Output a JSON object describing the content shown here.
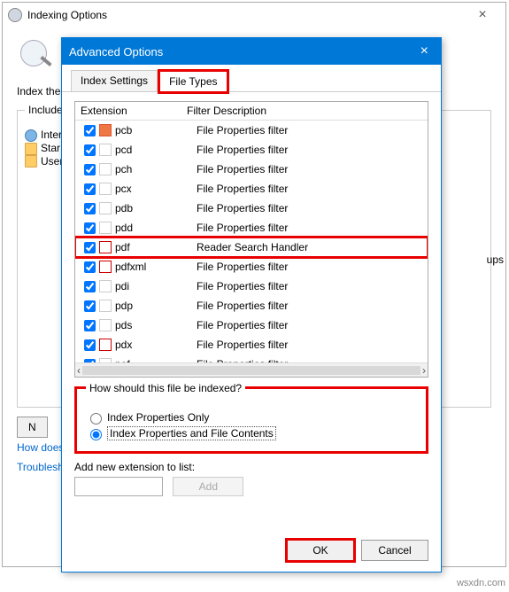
{
  "parent": {
    "title": "Indexing Options",
    "indexThe": "Index the",
    "includedLabel": "Included",
    "items": [
      "Inter",
      "Star",
      "User"
    ],
    "behindRight": "ups",
    "modifyBtn": "N",
    "closeBtn": "Close",
    "link1": "How does",
    "link2": "Troublesh"
  },
  "child": {
    "title": "Advanced Options",
    "tab1": "Index Settings",
    "tab2": "File Types",
    "headerExt": "Extension",
    "headerDesc": "Filter Description",
    "rows": [
      {
        "ext": "pcb",
        "desc": "File Properties filter",
        "icon": "office"
      },
      {
        "ext": "pcd",
        "desc": "File Properties filter",
        "icon": "ps"
      },
      {
        "ext": "pch",
        "desc": "File Properties filter",
        "icon": "off"
      },
      {
        "ext": "pcx",
        "desc": "File Properties filter",
        "icon": "off"
      },
      {
        "ext": "pdb",
        "desc": "File Properties filter",
        "icon": "ps"
      },
      {
        "ext": "pdd",
        "desc": "File Properties filter",
        "icon": "ps"
      },
      {
        "ext": "pdf",
        "desc": "Reader Search Handler",
        "icon": "pdf",
        "hl": true
      },
      {
        "ext": "pdfxml",
        "desc": "File Properties filter",
        "icon": "pdf"
      },
      {
        "ext": "pdi",
        "desc": "File Properties filter",
        "icon": "off"
      },
      {
        "ext": "pdp",
        "desc": "File Properties filter",
        "icon": "ps"
      },
      {
        "ext": "pds",
        "desc": "File Properties filter",
        "icon": "off"
      },
      {
        "ext": "pdx",
        "desc": "File Properties filter",
        "icon": "pdf"
      },
      {
        "ext": "pef",
        "desc": "File Properties filter",
        "icon": "off"
      }
    ],
    "radioGroupLabel": "How should this file be indexed?",
    "radio1": "Index Properties Only",
    "radio2": "Index Properties and File Contents",
    "addLabel": "Add new extension to list:",
    "addBtn": "Add",
    "okBtn": "OK",
    "cancelBtn": "Cancel",
    "scrollLeft": "‹",
    "scrollRight": "›"
  },
  "watermark": "wsxdn.com"
}
